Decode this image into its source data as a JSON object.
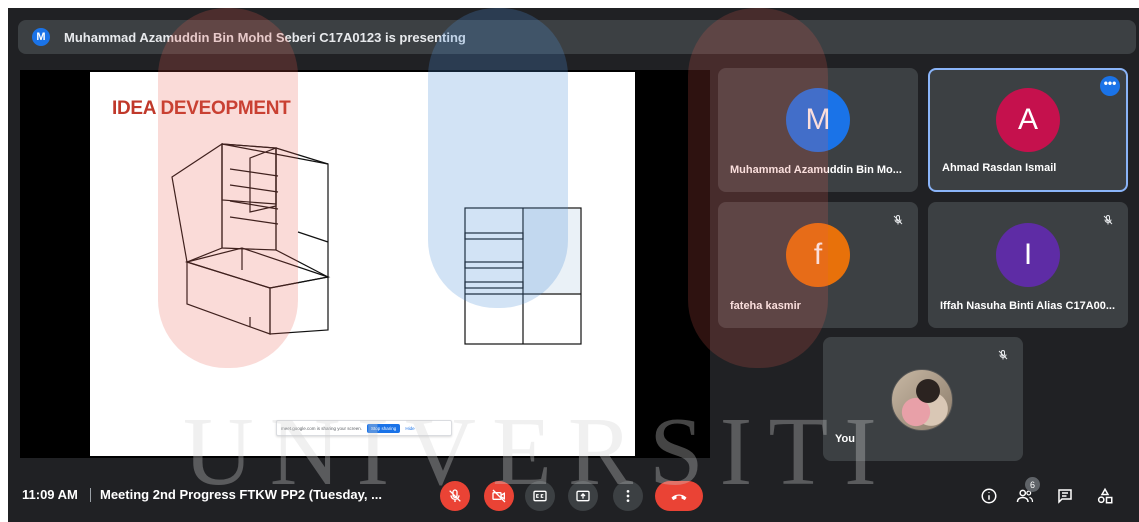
{
  "banner": {
    "avatar_letter": "M",
    "text": "Muhammad Azamuddin Bin Mohd Seberi C17A0123 is presenting"
  },
  "slide": {
    "title": "IDEA DEVEOPMENT",
    "share_bar": {
      "message": "meet.google.com is sharing your screen.",
      "stop_label": "Stop sharing",
      "hide_label": "Hide"
    }
  },
  "participants": [
    {
      "letter": "M",
      "name": "Muhammad Azamuddin Bin Mo...",
      "color": "#1a73e8",
      "muted": false,
      "active": false
    },
    {
      "letter": "A",
      "name": "Ahmad Rasdan Ismail",
      "color": "#c5114d",
      "muted": false,
      "active": true
    },
    {
      "letter": "f",
      "name": "fateha kasmir",
      "color": "#e8710a",
      "muted": true,
      "active": false
    },
    {
      "letter": "I",
      "name": "Iffah Nasuha Binti Alias C17A00...",
      "color": "#5e2ca5",
      "muted": true,
      "active": false
    }
  ],
  "self_tile": {
    "name": "You",
    "muted": true
  },
  "bottom": {
    "time": "11:09 AM",
    "meeting_title": "Meeting 2nd Progress FTKW PP2 (Tuesday, ...",
    "people_count": "6"
  },
  "watermark": {
    "text": "UNIVERSITI"
  },
  "colors": {
    "background": "#202124",
    "tile": "#3c4043",
    "danger": "#ea4335",
    "accent": "#1a73e8"
  }
}
